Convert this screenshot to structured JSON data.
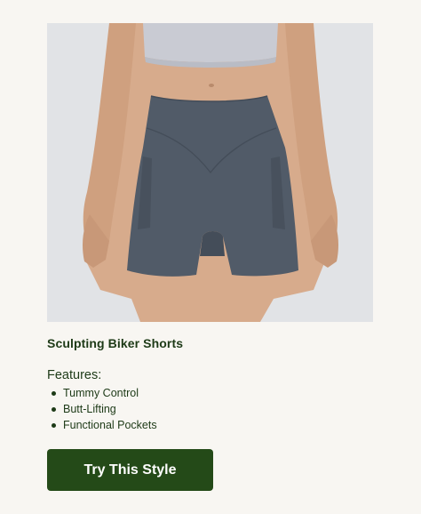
{
  "product": {
    "title": "Sculpting Biker Shorts",
    "image_alt": "Model wearing slate gray high-waisted biker shorts with side pockets"
  },
  "features": {
    "heading": "Features:",
    "items": [
      "Tummy Control",
      "Butt-Lifting",
      "Functional Pockets"
    ]
  },
  "cta": {
    "label": "Try This Style"
  },
  "colors": {
    "background": "#f8f6f2",
    "text": "#1d3a17",
    "button": "#244a18",
    "shorts": "#4f5a66"
  }
}
